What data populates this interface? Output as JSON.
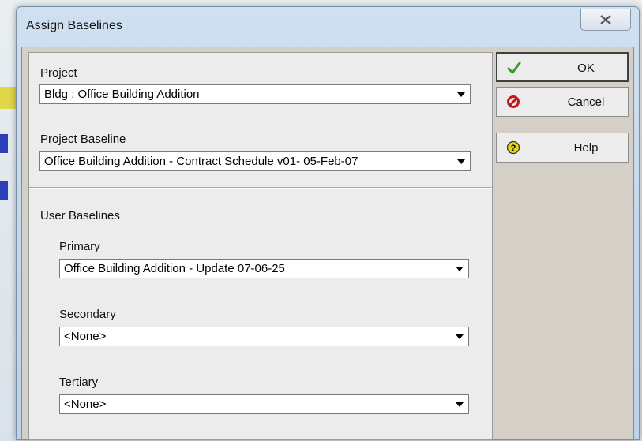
{
  "window": {
    "title": "Assign Baselines"
  },
  "project": {
    "label": "Project",
    "value": "Bldg : Office Building Addition"
  },
  "project_baseline": {
    "label": "Project Baseline",
    "value": "Office Building Addition - Contract Schedule v01- 05-Feb-07"
  },
  "user_baselines": {
    "label": "User Baselines",
    "primary": {
      "label": "Primary",
      "value": "Office Building Addition - Update 07-06-25"
    },
    "secondary": {
      "label": "Secondary",
      "value": "<None>"
    },
    "tertiary": {
      "label": "Tertiary",
      "value": "<None>"
    }
  },
  "buttons": {
    "ok": "OK",
    "cancel": "Cancel",
    "help": "Help"
  },
  "colors": {
    "ok_check": "#3a9a2a",
    "cancel_icon": "#c0181e",
    "help_icon": "#e8d21a"
  },
  "icons": {
    "ok": "check-icon",
    "cancel": "no-entry-icon",
    "help": "question-icon",
    "close": "close-icon",
    "dropdown": "chevron-down-icon"
  }
}
